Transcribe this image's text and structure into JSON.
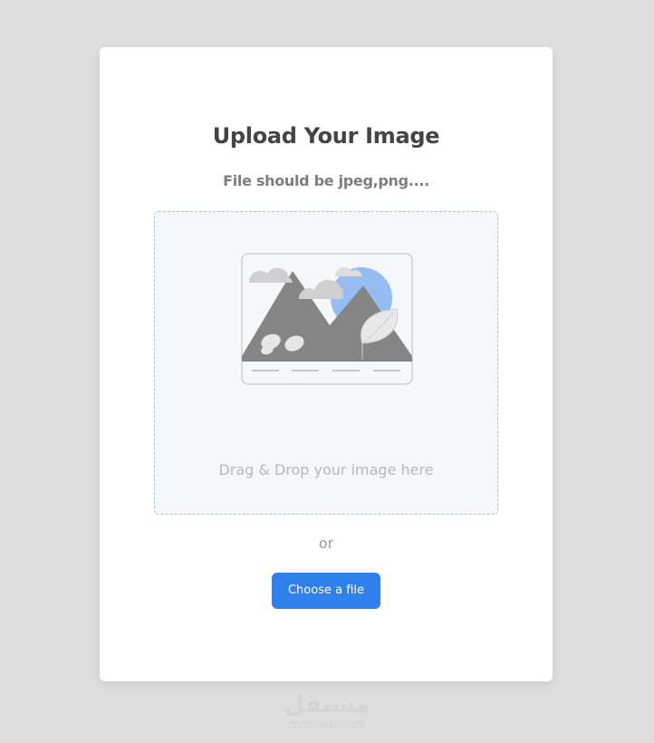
{
  "upload_card": {
    "title": "Upload Your Image",
    "subtitle": "File should be jpeg,png....",
    "dropzone": {
      "illustration_icon": "image-placeholder-icon",
      "label": "Drag & Drop your image here"
    },
    "separator": "or",
    "choose_button_label": "Choose a file"
  },
  "watermark": {
    "arabic": "مستقل",
    "latin": "mostaqi.com"
  },
  "colors": {
    "background": "#dedede",
    "card": "#ffffff",
    "dropzone_bg": "#f5f7fb",
    "dropzone_border": "#a7c5e6",
    "accent": "#2f80ed",
    "title": "#444444",
    "subtitle": "#7e7e7e",
    "drop_text": "#b8b8b8"
  }
}
